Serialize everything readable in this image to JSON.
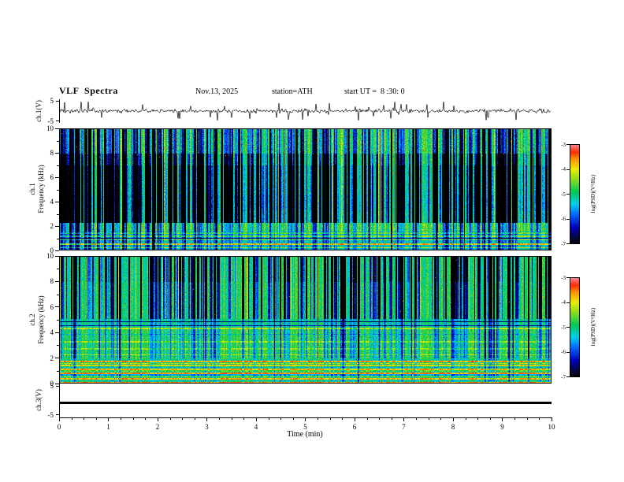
{
  "header": {
    "title": "VLF  Spectra",
    "date": "Nov.13, 2025",
    "station": "station=ATH",
    "start_ut": "start UT =  8 :30: 0"
  },
  "xaxis": {
    "label": "Time (min)",
    "ticks": [
      "0",
      "1",
      "2",
      "3",
      "4",
      "5",
      "6",
      "7",
      "8",
      "9",
      "10"
    ]
  },
  "panels": {
    "ch1_wave": {
      "ylabel": "ch.1(V)",
      "yticks": [
        "5",
        "-5"
      ]
    },
    "ch1_spec": {
      "ylabel_channel": "ch.1",
      "ylabel_axis": "Frequency (kHz)",
      "yticks": [
        "0",
        "2",
        "4",
        "6",
        "8",
        "10"
      ]
    },
    "ch2_spec": {
      "ylabel_channel": "ch.2",
      "ylabel_axis": "Frequency (kHz)",
      "yticks": [
        "0",
        "2",
        "4",
        "6",
        "8",
        "10"
      ]
    },
    "ch3_wave": {
      "ylabel": "ch.3(V)",
      "yticks": [
        "5",
        "-5"
      ]
    }
  },
  "colorbar": {
    "label": "log(PSD)(V²/Hz)",
    "ticks": [
      "-3",
      "-4",
      "-5",
      "-6",
      "-7"
    ],
    "zmin": -7,
    "zmax": -3
  },
  "chart_data": [
    {
      "type": "line",
      "name": "ch.1(V) time series",
      "xlabel": "Time (min)",
      "ylabel": "ch.1(V)",
      "xlim": [
        0,
        10
      ],
      "ylim": [
        -5,
        5
      ],
      "description": "continuous broadband noise trace centred on 0 V (about ±1 V) with frequent impulsive sferic spikes reaching about ±4.5 V throughout the 10 minutes"
    },
    {
      "type": "heatmap",
      "name": "ch.1 spectrogram",
      "xlabel": "Time (min)",
      "ylabel": "Frequency (kHz)",
      "xlim": [
        0,
        10
      ],
      "ylim": [
        0,
        10
      ],
      "zlim": [
        -7,
        -3
      ],
      "zlabel": "log(PSD)(V²/Hz)",
      "colormap": "rainbow, black at low end (black → blue → cyan → green → yellow → red → pink)",
      "features": [
        "green / yellow-green band from 7 to 10 kHz with scattered red speckles",
        "dense dark-blue vertical sferic streaks across 2–7 kHz on a cyan-blue background",
        "yellow-green horizontal band near 1.6–2.2 kHz",
        "bright yellow/orange/red horizontal harmonic lines below 1.5 kHz",
        "thin dark horizontal line near 1 kHz"
      ]
    },
    {
      "type": "heatmap",
      "name": "ch.2 spectrogram",
      "xlabel": "Time (min)",
      "ylabel": "Frequency (kHz)",
      "xlim": [
        0,
        10
      ],
      "ylim": [
        0,
        10
      ],
      "zlim": [
        -7,
        -3
      ],
      "zlabel": "log(PSD)(V²/Hz)",
      "colormap": "rainbow, black at low end (black → blue → cyan → green → yellow → red → pink)",
      "features": [
        "green background with strong dark-blue vertical sferic streaks from 5 to 10 kHz",
        "dark horizontal lines near 4.6 and 4.9 kHz and a reddish line near 4.4 kHz",
        "smoother green/cyan background 2–4.5 kHz with faint reddish striations",
        "strong red/yellow/green horizontal power-line harmonic bands below 2 kHz"
      ]
    },
    {
      "type": "line",
      "name": "ch.3(V) time series",
      "xlabel": "Time (min)",
      "ylabel": "ch.3(V)",
      "xlim": [
        0,
        10
      ],
      "ylim": [
        -5,
        5
      ],
      "description": "flat thick black trace just below 0 V for the whole interval (no signal on channel 3)"
    }
  ]
}
